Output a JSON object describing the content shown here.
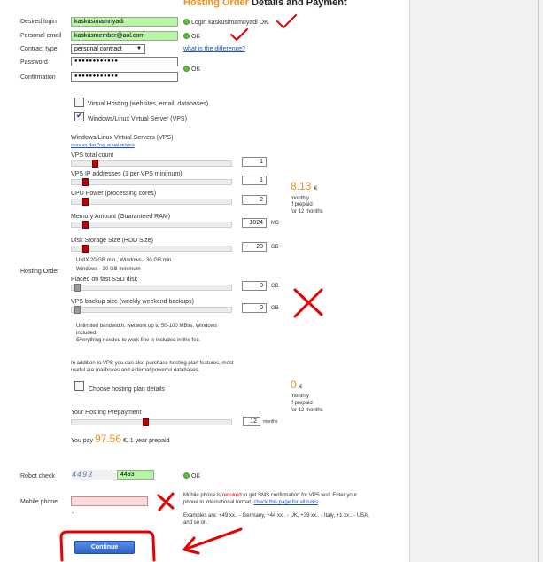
{
  "header": {
    "title_orange": "Hosting Order",
    "title_rest": " Details and Payment"
  },
  "form": {
    "desired_login": {
      "label": "Desired login",
      "value": "kaskusimamriyadi",
      "status": "Login kaskusimamriyadi OK."
    },
    "personal_email": {
      "label": "Personal email",
      "value": "kaskusmember@aol.com",
      "status": "OK"
    },
    "contract_type": {
      "label": "Contract type",
      "value": "personal contract",
      "link": "what is the difference?"
    },
    "password": {
      "label": "Password",
      "value": "●●●●●●●●●●●●",
      "status": "OK"
    },
    "confirmation": {
      "label": "Confirmation",
      "value": "●●●●●●●●●●●●"
    }
  },
  "hosting": {
    "section_label": "Hosting Order",
    "virtual_hosting": "Virtual Hosting (websites, email, databases)",
    "vps_option": "Windows/Linux Virtual Server (VPS)",
    "vps_heading": "Windows/Linux Virtual Servers (VPS)",
    "vps_more_link": "more on NavProg virtual servers",
    "sliders": [
      {
        "label": "VPS total count",
        "value": "1",
        "unit": "",
        "fraction": 0.12
      },
      {
        "label": "VPS IP addresses (1 per VPS minimum)",
        "value": "1",
        "unit": "",
        "fraction": 0.05
      },
      {
        "label": "CPU Power (processing cores)",
        "value": "2",
        "unit": "",
        "fraction": 0.05
      },
      {
        "label": "Memory Amount (Guaranteed RAM)",
        "value": "1024",
        "unit": "MB",
        "fraction": 0.05
      },
      {
        "label": "Disk Storage Size (HDD Size)",
        "value": "20",
        "unit": "GB",
        "fraction": 0.05
      },
      {
        "label": "Placed on fast SSD disk",
        "value": "0",
        "unit": "GB",
        "fraction": 0
      },
      {
        "label": "VPS backup size (weekly weekend backups)",
        "value": "0",
        "unit": "GB",
        "fraction": 0
      }
    ],
    "disk_note_1": "UNIX 20 GB min., Windows - 30 GB min.",
    "disk_note_2": "Windows - 30 GB minimum",
    "price": {
      "amount": "8.13",
      "currency": "€",
      "line1": "monthly",
      "line2": "if prepaid",
      "line3": "for 12 months"
    },
    "bandwidth_1": "Unlimited bandwidth. Network up to 50-100 MBits. Windows",
    "bandwidth_2": "included.",
    "bandwidth_3": "Everything needed to work fine is included in the fee.",
    "addon_1": "In addition to VPS you can also purchase hosting plan features, most",
    "addon_2": "useful are mailboxes and external powerful databases.",
    "choose_details": "Choose hosting plan details",
    "addon_price": {
      "amount": "0",
      "currency": "€",
      "line1": "monthly",
      "line2": "if prepaid",
      "line3": "for 12 months"
    },
    "prepayment": {
      "label": "Your Hosting Prepayment",
      "value": "12",
      "unit": "months",
      "fraction": 0.45
    },
    "you_pay": {
      "prefix": "You pay",
      "amount": "97.56",
      "suffix": "€, 1 year prepaid"
    }
  },
  "robot": {
    "label": "Robot check",
    "captcha": "4493",
    "value": "4493",
    "status": "OK"
  },
  "mobile": {
    "label": "Mobile phone",
    "value": "",
    "dash": "-",
    "note_1a": "Mobile phone is ",
    "note_1b": "required",
    "note_1c": " to get SMS confirmation for VPS test. Enter your",
    "note_2a": "phone in international format, ",
    "note_2b": "check this page for all rules",
    "note_2c": ".",
    "examples_1": "Examples are: +49 xx.. - Germany, +44 xx.. - UK, +39 xx.. - Italy, +1 xx.. - USA,",
    "examples_2": "and so on."
  },
  "actions": {
    "continue": "Continue"
  },
  "colors": {
    "accent": "#f08d1c",
    "annotation": "#e60000",
    "button": "#2f64cc",
    "ok": "#5cc23d"
  }
}
